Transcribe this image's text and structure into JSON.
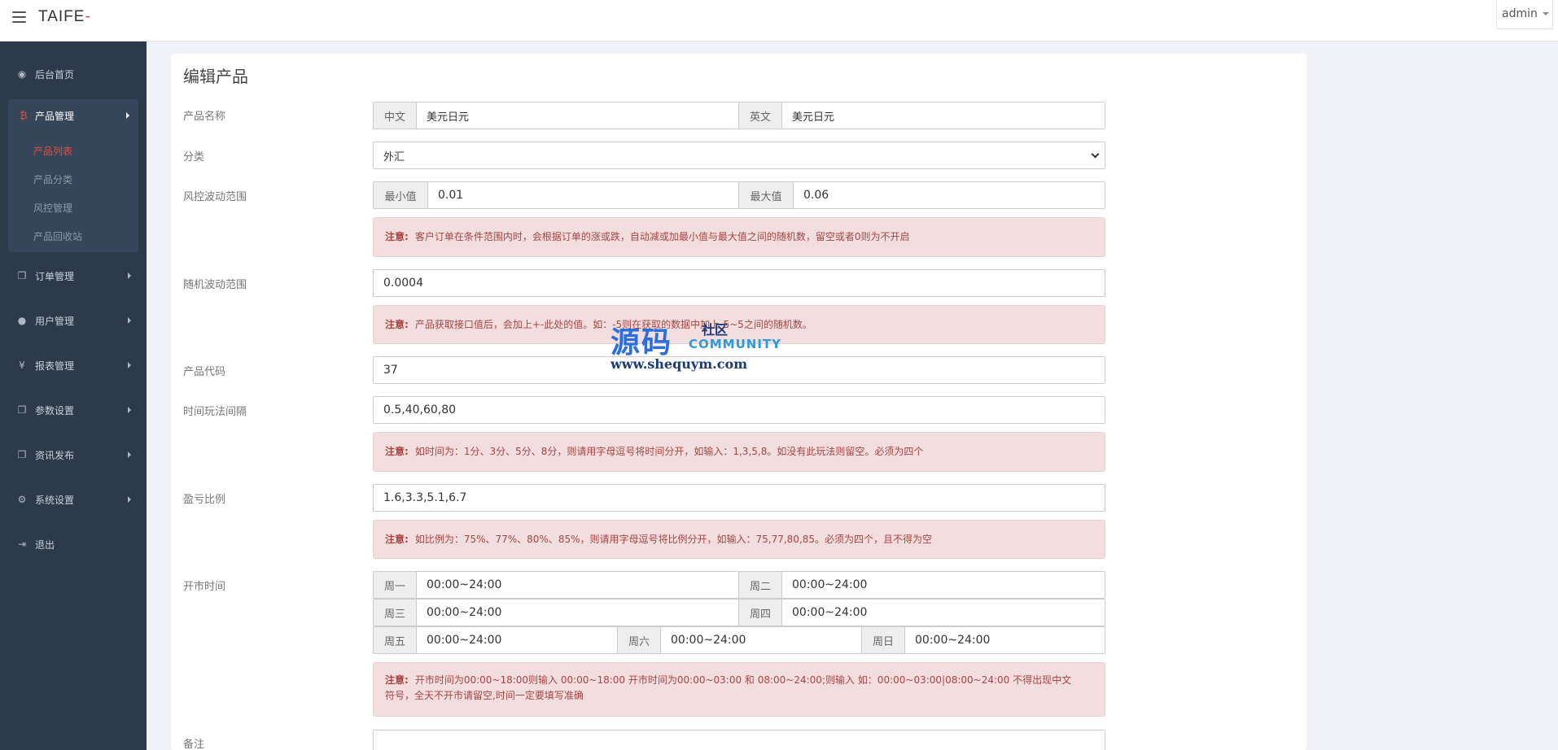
{
  "header": {
    "logo_main": "TAIFE",
    "logo_accent": "-",
    "user": "admin"
  },
  "sidebar": {
    "dashboard": {
      "label": "后台首页",
      "icon": "dashboard-icon"
    },
    "product_mgmt": {
      "label": "产品管理",
      "icon": "bitcoin-icon"
    },
    "product_sub": [
      "产品列表",
      "产品分类",
      "风控管理",
      "产品回收站"
    ],
    "order_mgmt": {
      "label": "订单管理",
      "icon": "copy-icon"
    },
    "user_mgmt": {
      "label": "用户管理",
      "icon": "user-icon"
    },
    "report_mgmt": {
      "label": "报表管理",
      "icon": "yen-icon"
    },
    "param_settings": {
      "label": "参数设置",
      "icon": "copy-icon"
    },
    "news_publish": {
      "label": "资讯发布",
      "icon": "copy-icon"
    },
    "system_settings": {
      "label": "系统设置",
      "icon": "gears-icon"
    },
    "logout": {
      "label": "退出",
      "icon": "signout-icon"
    }
  },
  "form": {
    "title": "编辑产品",
    "product_name": {
      "label": "产品名称",
      "cn_addon": "中文",
      "cn_value": "美元日元",
      "en_addon": "英文",
      "en_value": "美元日元"
    },
    "category": {
      "label": "分类",
      "value": "外汇"
    },
    "risk_range": {
      "label": "风控波动范围",
      "min_addon": "最小值",
      "min_value": "0.01",
      "max_addon": "最大值",
      "max_value": "0.06"
    },
    "risk_note": {
      "prefix": "注意:",
      "text": "客户订单在条件范围内时，会根据订单的涨或跌，自动减或加最小值与最大值之间的随机数，留空或者0则为不开启"
    },
    "random_range": {
      "label": "随机波动范围",
      "value": "0.0004"
    },
    "random_note": {
      "prefix": "注意:",
      "text": "产品获取接口值后，会加上+-此处的值。如：-5则在获取的数据中加上-5~5之间的随机数。"
    },
    "product_code": {
      "label": "产品代码",
      "value": "37"
    },
    "time_interval": {
      "label": "时间玩法间隔",
      "value": "0.5,40,60,80"
    },
    "time_note": {
      "prefix": "注意:",
      "text": "如时间为：1分、3分、5分、8分，则请用字母逗号将时间分开，如输入：1,3,5,8。如没有此玩法则留空。必须为四个"
    },
    "profit_ratio": {
      "label": "盈亏比例",
      "value": "1.6,3.3,5.1,6.7"
    },
    "profit_note": {
      "prefix": "注意:",
      "text": "如比例为：75%、77%、80%、85%，则请用字母逗号将比例分开，如输入：75,77,80,85。必须为四个，且不得为空"
    },
    "open_time": {
      "label": "开市时间",
      "mon": {
        "day": "周一",
        "value": "00:00~24:00"
      },
      "tue": {
        "day": "周二",
        "value": "00:00~24:00"
      },
      "wed": {
        "day": "周三",
        "value": "00:00~24:00"
      },
      "thu": {
        "day": "周四",
        "value": "00:00~24:00"
      },
      "fri": {
        "day": "周五",
        "value": "00:00~24:00"
      },
      "sat": {
        "day": "周六",
        "value": "00:00~24:00"
      },
      "sun": {
        "day": "周日",
        "value": "00:00~24:00"
      }
    },
    "open_note": {
      "prefix": "注意:",
      "line1": "开市时间为00:00~18:00则输入 00:00~18:00 开市时间为00:00~03:00 和 08:00~24:00;则输入 如：00:00~03:00|08:00~24:00 不得出现中文",
      "line2": "符号，全天不开市请留空,时间一定要填写准确"
    },
    "remark": {
      "label": "备注"
    }
  },
  "watermark": {
    "big": "源码",
    "small_cn": "社区",
    "small_en": "COMMUNITY",
    "url": "www.shequym.com"
  }
}
